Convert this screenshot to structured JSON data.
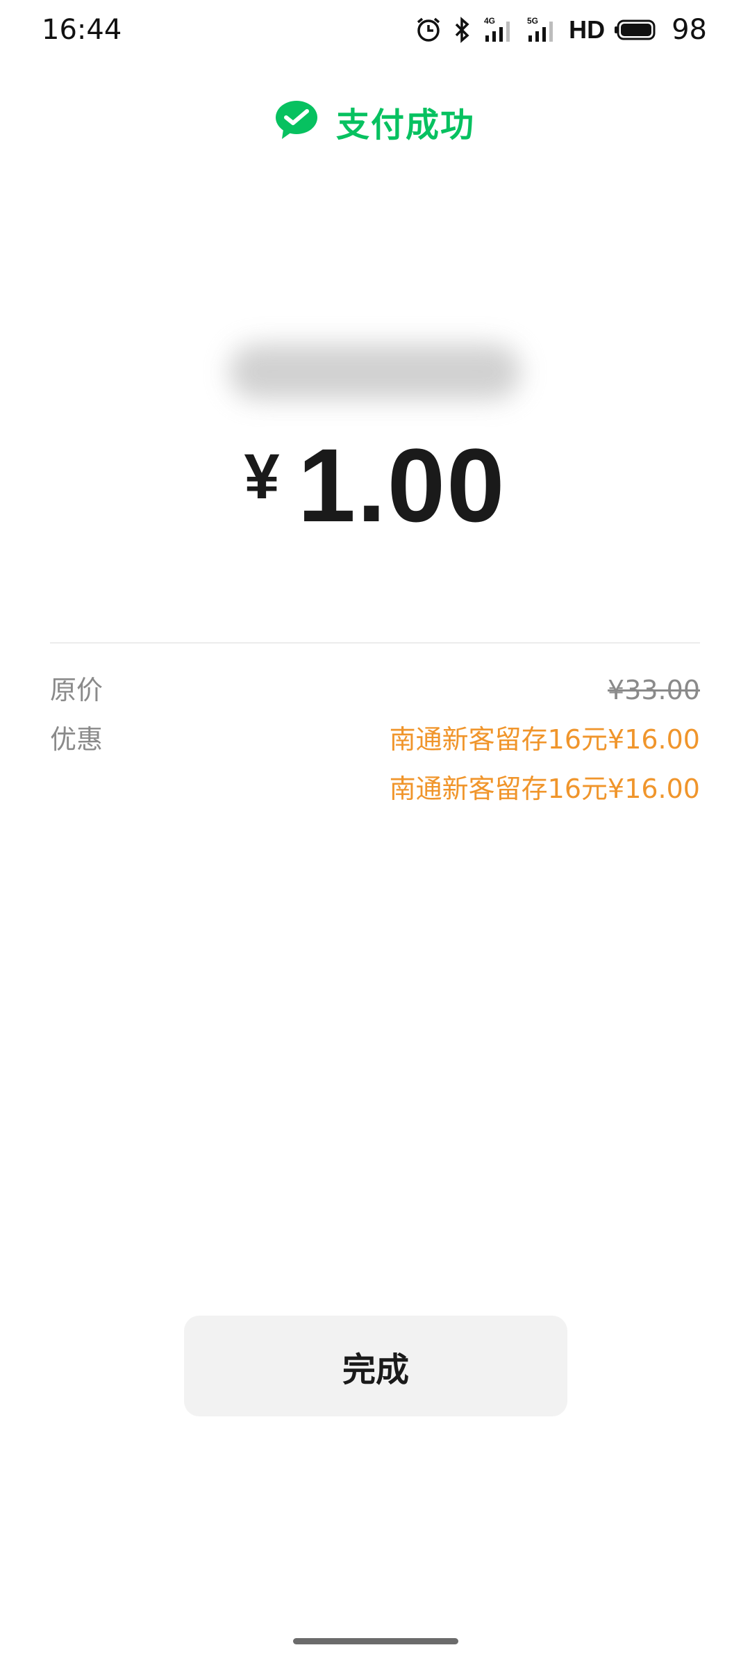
{
  "status_bar": {
    "time": "16:44",
    "network_1": "4G",
    "network_2": "5G",
    "hd_label": "HD",
    "battery": "98",
    "icons": [
      "alarm-icon",
      "bluetooth-icon",
      "signal-4g-icon",
      "signal-5g-icon",
      "hd-icon",
      "battery-icon"
    ]
  },
  "header": {
    "title": "支付成功",
    "icon": "wechat-pay-icon",
    "accent_color": "#07c160"
  },
  "payment": {
    "currency": "¥",
    "amount": "1.00"
  },
  "details": {
    "original_price_label": "原价",
    "original_price": "¥33.00",
    "discount_label": "优惠",
    "discounts": [
      "南通新客留存16元¥16.00",
      "南通新客留存16元¥16.00"
    ],
    "discount_color": "#f0952b"
  },
  "actions": {
    "done_label": "完成"
  }
}
